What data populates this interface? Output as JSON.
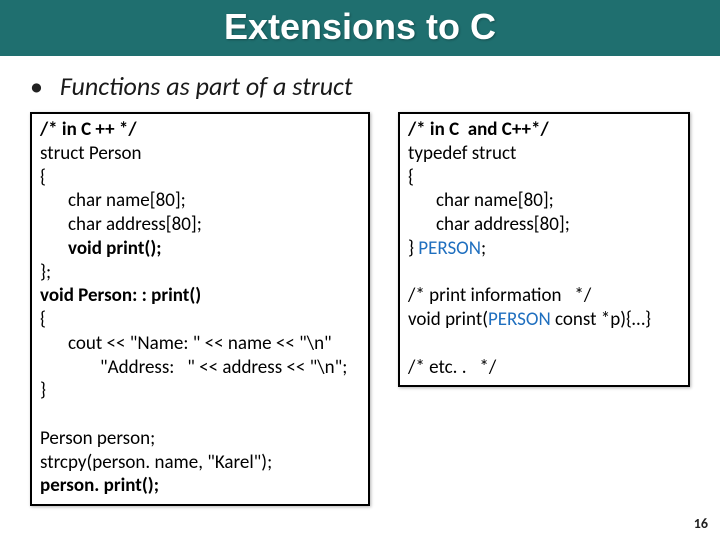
{
  "title": "Extensions to C",
  "bullet": "Functions as part of a struct",
  "page_number": "16",
  "left": {
    "c1": "/* in C ++ */",
    "l1": "struct Person",
    "l2": "{",
    "l3": "char name[80];",
    "l4": "char address[80];",
    "l5": "void print();",
    "l6": "};",
    "l7": "void Person: : print()",
    "l8": "{",
    "l9": "cout << \"Name: \" << name << \"\\n\"",
    "l10": "\"Address:   \" << address << \"\\n\";",
    "l11": "}",
    "sp": " ",
    "l12": "Person person;",
    "l13": "strcpy(person. name, \"Karel\");",
    "l14": "person. print();"
  },
  "right": {
    "c1": "/* in C  and C++*/",
    "l1": "typedef struct",
    "l2": "{",
    "l3": "char name[80];",
    "l4": "char address[80];",
    "l5a": "} ",
    "l5b": "PERSON",
    "l5c": ";",
    "sp": " ",
    "l6": "/* print information   */",
    "l7a": "void print(",
    "l7b": "PERSON",
    "l7c": " const *p){…}",
    "sp2": " ",
    "l8": "/* etc. .   */"
  }
}
